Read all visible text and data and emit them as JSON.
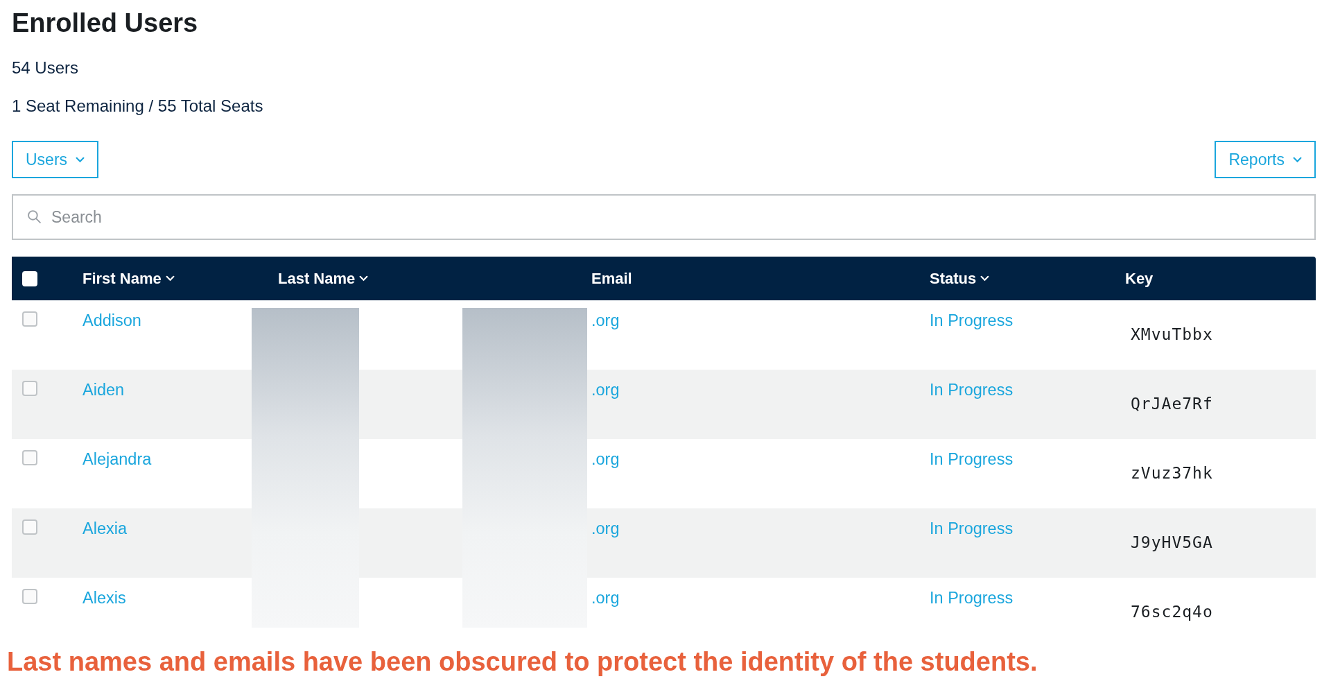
{
  "title": "Enrolled Users",
  "user_count": "54 Users",
  "seats": "1 Seat Remaining / 55 Total Seats",
  "users_menu": {
    "label": "Users"
  },
  "reports_menu": {
    "label": "Reports"
  },
  "search": {
    "placeholder": "Search"
  },
  "table": {
    "select_all": {
      "checked": false
    },
    "columns": [
      {
        "label": "First Name",
        "sortable": true
      },
      {
        "label": "Last Name",
        "sortable": true
      },
      {
        "label": "Email",
        "sortable": false
      },
      {
        "label": "Status",
        "sortable": true
      },
      {
        "label": "Key",
        "sortable": false
      }
    ],
    "rows": [
      {
        "checked": false,
        "first_name": "Addison",
        "email": ".org",
        "status": "In Progress",
        "key": "XMvuTbbx"
      },
      {
        "checked": false,
        "first_name": "Aiden",
        "email": ".org",
        "status": "In Progress",
        "key": "QrJAe7Rf"
      },
      {
        "checked": false,
        "first_name": "Alejandra",
        "email": ".org",
        "status": "In Progress",
        "key": "zVuz37hk"
      },
      {
        "checked": false,
        "first_name": "Alexia",
        "email": ".org",
        "status": "In Progress",
        "key": "J9yHV5GA"
      },
      {
        "checked": false,
        "first_name": "Alexis",
        "email": ".org",
        "status": "In Progress",
        "key": "76sc2q4o"
      }
    ]
  },
  "note": "Last names and emails have been obscured to protect the identity of the students."
}
